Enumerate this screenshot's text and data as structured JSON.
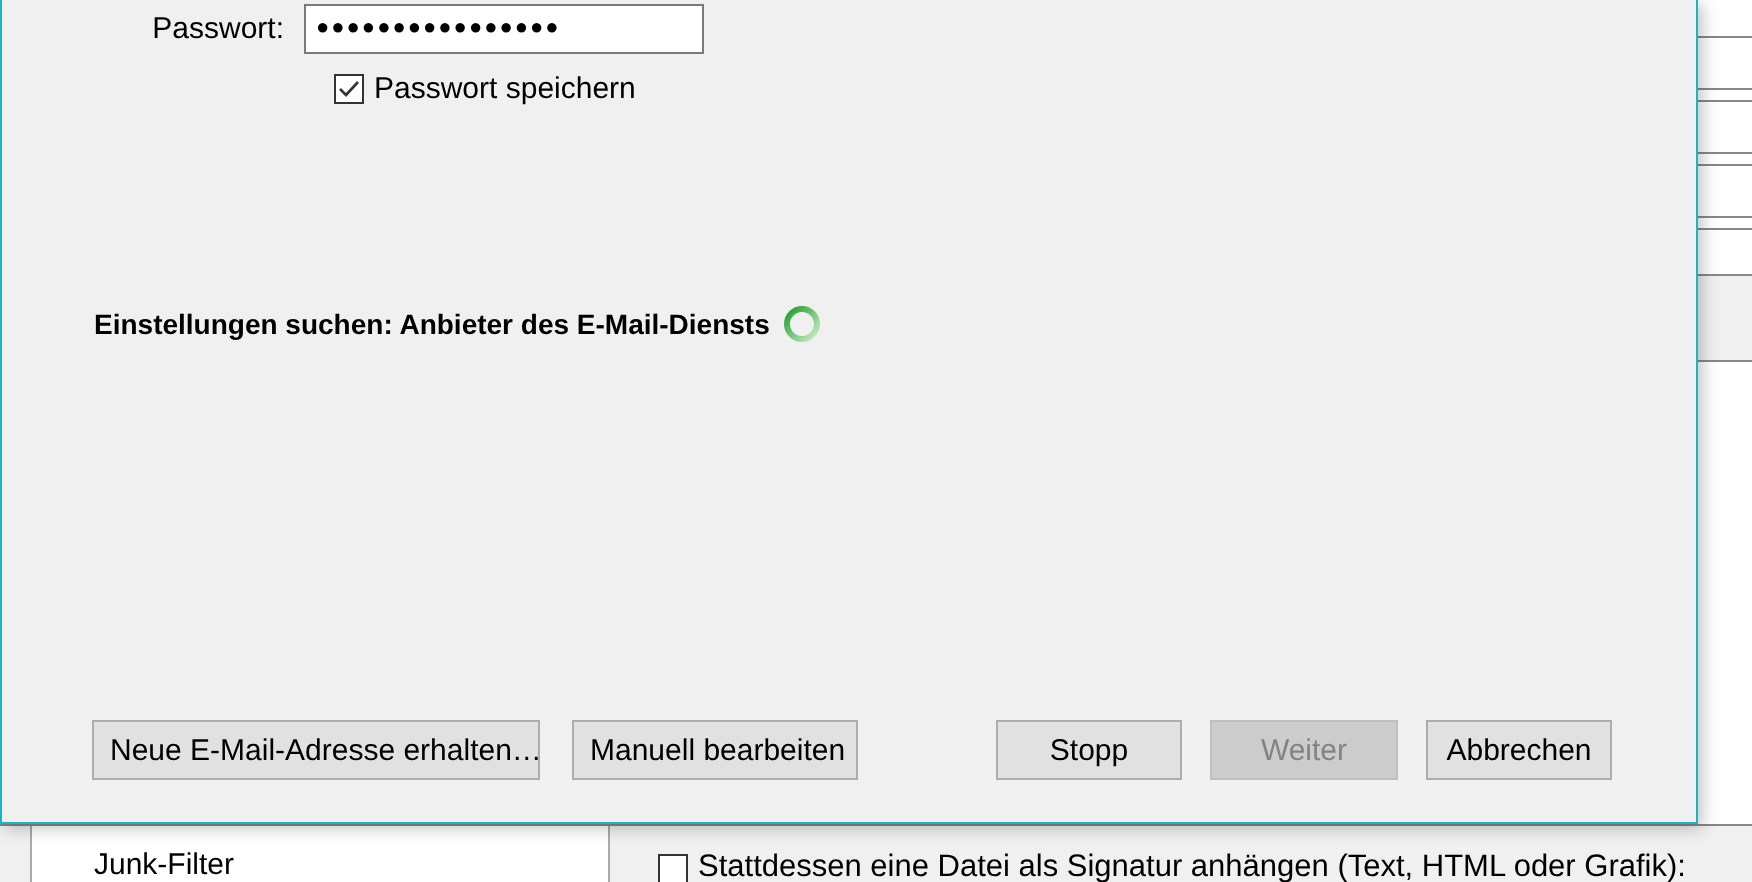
{
  "password": {
    "label": "Passwort:",
    "value": "●●●●●●●●●●●●●●●●"
  },
  "remember_password": {
    "label": "Passwort speichern",
    "checked": true
  },
  "status": {
    "text": "Einstellungen suchen: Anbieter des E-Mail-Diensts",
    "busy": true
  },
  "left_buttons": [
    {
      "label": "Neue E-Mail-Adresse erhalten…",
      "disabled": false
    },
    {
      "label": "Manuell bearbeiten",
      "disabled": false
    }
  ],
  "right_buttons": [
    {
      "label": "Stopp",
      "disabled": false
    },
    {
      "label": "Weiter",
      "disabled": true
    },
    {
      "label": "Abbrechen",
      "disabled": false
    }
  ],
  "background": {
    "sidebar_item": "Junk-Filter",
    "signature_option": {
      "label": "Stattdessen eine Datei als Signatur anhängen (Text, HTML oder Grafik):",
      "checked": false
    }
  }
}
